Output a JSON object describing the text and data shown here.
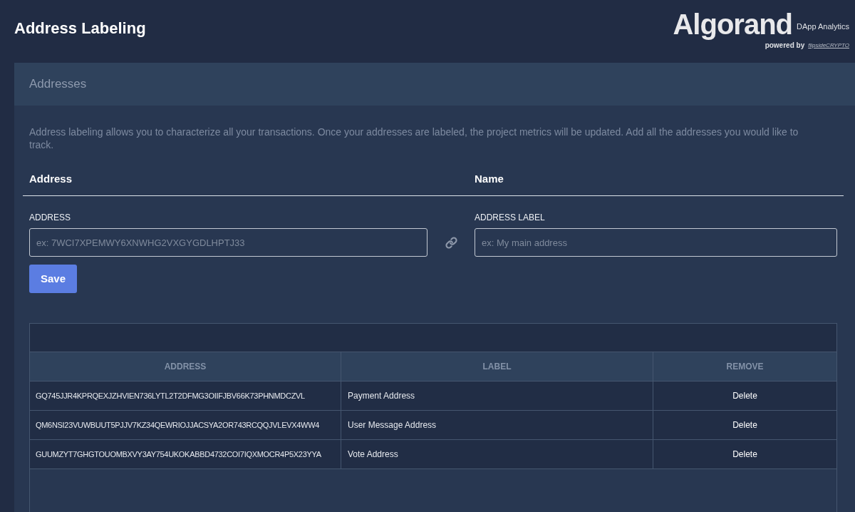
{
  "page_title": "Address Labeling",
  "logo": {
    "name": "Algorand",
    "product": "DApp Analytics",
    "powered_by": "powered by",
    "partner": "flipsideCRYPTO"
  },
  "panel": {
    "title": "Addresses",
    "description": "Address labeling allows you to characterize all your transactions. Once your addresses are labeled, the project metrics will be updated. Add all the addresses you would like to track.",
    "form_headings": [
      "Address",
      "Name"
    ],
    "fields": [
      {
        "label": "ADDRESS",
        "placeholder": "ex: 7WCI7XPEMWY6XNWHG2VXGYGDLHPTJ33"
      },
      {
        "label": "ADDRESS LABEL",
        "placeholder": "ex: My main address"
      }
    ],
    "save_button": "Save"
  },
  "table": {
    "columns": [
      "ADDRESS",
      "LABEL",
      "REMOVE"
    ],
    "rows": [
      {
        "address": "GQ745JJR4KPRQEXJZHVIEN736LYTL2T2DFMG3OIIFJBV66K73PHNMDCZVL",
        "label": "Payment Address",
        "action": "Delete"
      },
      {
        "address": "QM6NSI23VUWBUUT5PJJV7KZ34QEWRIOJJACSYA2OR743RCQQJVLEVX4WW4",
        "label": "User Message Address",
        "action": "Delete"
      },
      {
        "address": "GUUMZYT7GHGTOUOMBXVY3AY754UKOKABBD4732COI7IQXMOCR4P5X23YYA",
        "label": "Vote Address",
        "action": "Delete"
      }
    ]
  }
}
